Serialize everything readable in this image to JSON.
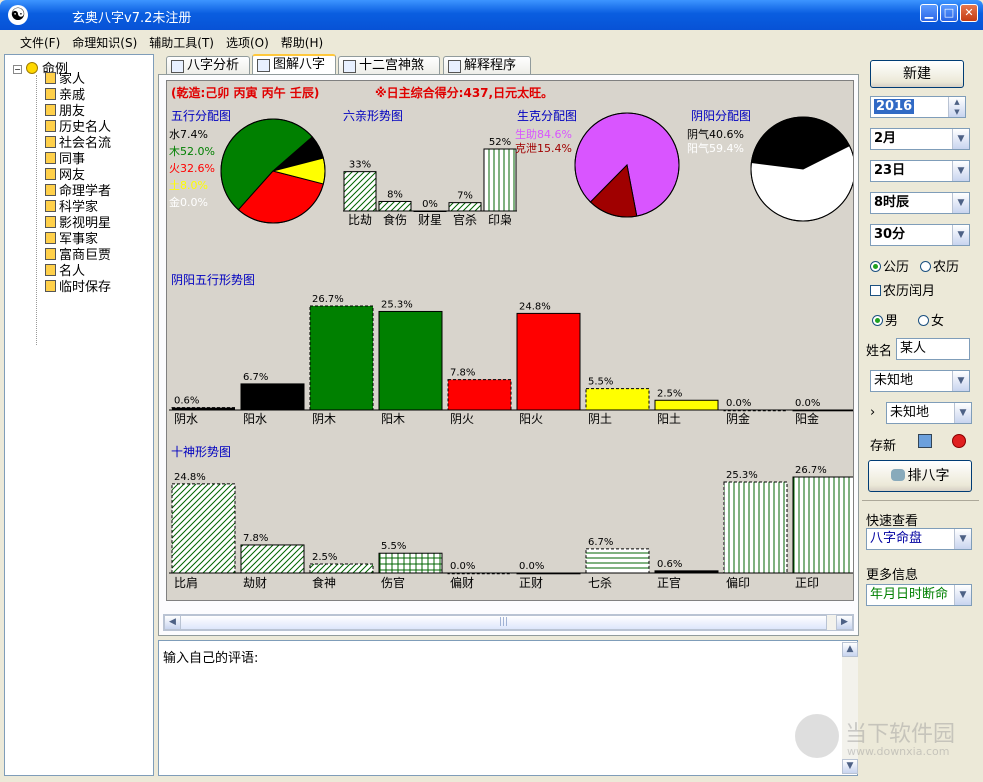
{
  "window": {
    "title": "玄奥八字v7.2未注册",
    "logo": "☯",
    "min": "▁",
    "max": "□",
    "close": "✕"
  },
  "menu": [
    "文件(F)",
    "命理知识(S)",
    "辅助工具(T)",
    "选项(O)",
    "帮助(H)"
  ],
  "tree": {
    "root": "命例",
    "toggle": "−",
    "items": [
      "家人",
      "亲戚",
      "朋友",
      "历史名人",
      "社会名流",
      "同事",
      "网友",
      "命理学者",
      "科学家",
      "影视明星",
      "军事家",
      "富商巨贾",
      "名人",
      "临时保存"
    ]
  },
  "tabs": [
    "八字分析",
    "图解八字",
    "十二宫神煞",
    "解释程序"
  ],
  "canvas": {
    "header": "(乾造:己卯 丙寅 丙午 壬辰)",
    "score": "※日主综合得分:437,日元太旺。",
    "wuxing": {
      "title": "五行分配图",
      "items": [
        {
          "label": "水7.4%",
          "value": 7.4,
          "color": "#000000"
        },
        {
          "label": "木52.0%",
          "value": 52.0,
          "color": "#008000"
        },
        {
          "label": "火32.6%",
          "value": 32.6,
          "color": "#ff0000"
        },
        {
          "label": "土8.0%",
          "value": 8.0,
          "color": "#ffff00"
        },
        {
          "label": "金0.0%",
          "value": 0.0,
          "color": "#ffffff"
        }
      ]
    },
    "liuqin": {
      "title": "六亲形势图",
      "bars": [
        {
          "name": "比劫",
          "pct": "33%",
          "value": 33
        },
        {
          "name": "食伤",
          "pct": "8%",
          "value": 8
        },
        {
          "name": "财星",
          "pct": "0%",
          "value": 0
        },
        {
          "name": "官杀",
          "pct": "7%",
          "value": 7
        },
        {
          "name": "印枭",
          "pct": "52%",
          "value": 52
        }
      ]
    },
    "shengke": {
      "title": "生克分配图",
      "items": [
        {
          "label": "生助84.6%",
          "value": 84.6,
          "color": "#d955ff"
        },
        {
          "label": "克泄15.4%",
          "value": 15.4,
          "color": "#a00000"
        }
      ]
    },
    "yinyang": {
      "title": "阴阳分配图",
      "items": [
        {
          "label": "阴气40.6%",
          "value": 40.6,
          "color": "#000000"
        },
        {
          "label": "阳气59.4%",
          "value": 59.4,
          "color": "#ffffff"
        }
      ]
    },
    "yywx": {
      "title": "阴阳五行形势图",
      "bars": [
        {
          "name": "阴水",
          "pct": "0.6%",
          "value": 0.6,
          "color": "#000000",
          "dashed": true
        },
        {
          "name": "阳水",
          "pct": "6.7%",
          "value": 6.7,
          "color": "#000000",
          "dashed": false
        },
        {
          "name": "阴木",
          "pct": "26.7%",
          "value": 26.7,
          "color": "#008000",
          "dashed": true
        },
        {
          "name": "阳木",
          "pct": "25.3%",
          "value": 25.3,
          "color": "#008000",
          "dashed": false
        },
        {
          "name": "阴火",
          "pct": "7.8%",
          "value": 7.8,
          "color": "#ff0000",
          "dashed": true
        },
        {
          "name": "阳火",
          "pct": "24.8%",
          "value": 24.8,
          "color": "#ff0000",
          "dashed": false
        },
        {
          "name": "阴土",
          "pct": "5.5%",
          "value": 5.5,
          "color": "#ffff00",
          "dashed": true
        },
        {
          "name": "阳土",
          "pct": "2.5%",
          "value": 2.5,
          "color": "#ffff00",
          "dashed": false
        },
        {
          "name": "阴金",
          "pct": "0.0%",
          "value": 0.0,
          "color": "#ffffff",
          "dashed": true
        },
        {
          "name": "阳金",
          "pct": "0.0%",
          "value": 0.0,
          "color": "#ffffff",
          "dashed": false
        }
      ]
    },
    "shishen": {
      "title": "十神形势图",
      "bars": [
        {
          "name": "比肩",
          "pct": "24.8%",
          "value": 24.8,
          "pattern": "diag",
          "dashed": true
        },
        {
          "name": "劫财",
          "pct": "7.8%",
          "value": 7.8,
          "pattern": "diag",
          "dashed": false
        },
        {
          "name": "食神",
          "pct": "2.5%",
          "value": 2.5,
          "pattern": "diag",
          "dashed": true
        },
        {
          "name": "伤官",
          "pct": "5.5%",
          "value": 5.5,
          "pattern": "grid",
          "dashed": false
        },
        {
          "name": "偏财",
          "pct": "0.0%",
          "value": 0.0,
          "pattern": "none",
          "dashed": true
        },
        {
          "name": "正财",
          "pct": "0.0%",
          "value": 0.0,
          "pattern": "none",
          "dashed": false
        },
        {
          "name": "七杀",
          "pct": "6.7%",
          "value": 6.7,
          "pattern": "horiz",
          "dashed": true
        },
        {
          "name": "正官",
          "pct": "0.6%",
          "value": 0.6,
          "pattern": "solid",
          "dashed": false
        },
        {
          "name": "偏印",
          "pct": "25.3%",
          "value": 25.3,
          "pattern": "vert",
          "dashed": true
        },
        {
          "name": "正印",
          "pct": "26.7%",
          "value": 26.7,
          "pattern": "vert",
          "dashed": false
        }
      ]
    }
  },
  "comment": {
    "label": "输入自己的评语:"
  },
  "right": {
    "new_btn": "新建",
    "year": "2016",
    "month": "2月",
    "day": "23日",
    "hour": "8时辰",
    "minute": "30分",
    "solar": "公历",
    "lunar": "农历",
    "leap": "农历闰月",
    "male": "男",
    "female": "女",
    "name_label": "姓名",
    "name_value": "某人",
    "place1": "未知地",
    "arrow": "›",
    "place2": "未知地",
    "save_label": "存新",
    "arrange_btn": "排八字",
    "quick_label": "快速查看",
    "quick_value": "八字命盘",
    "more_label": "更多信息",
    "more_value": "年月日时断命"
  },
  "watermark": {
    "text": "当下软件园",
    "url": "www.downxia.com"
  }
}
